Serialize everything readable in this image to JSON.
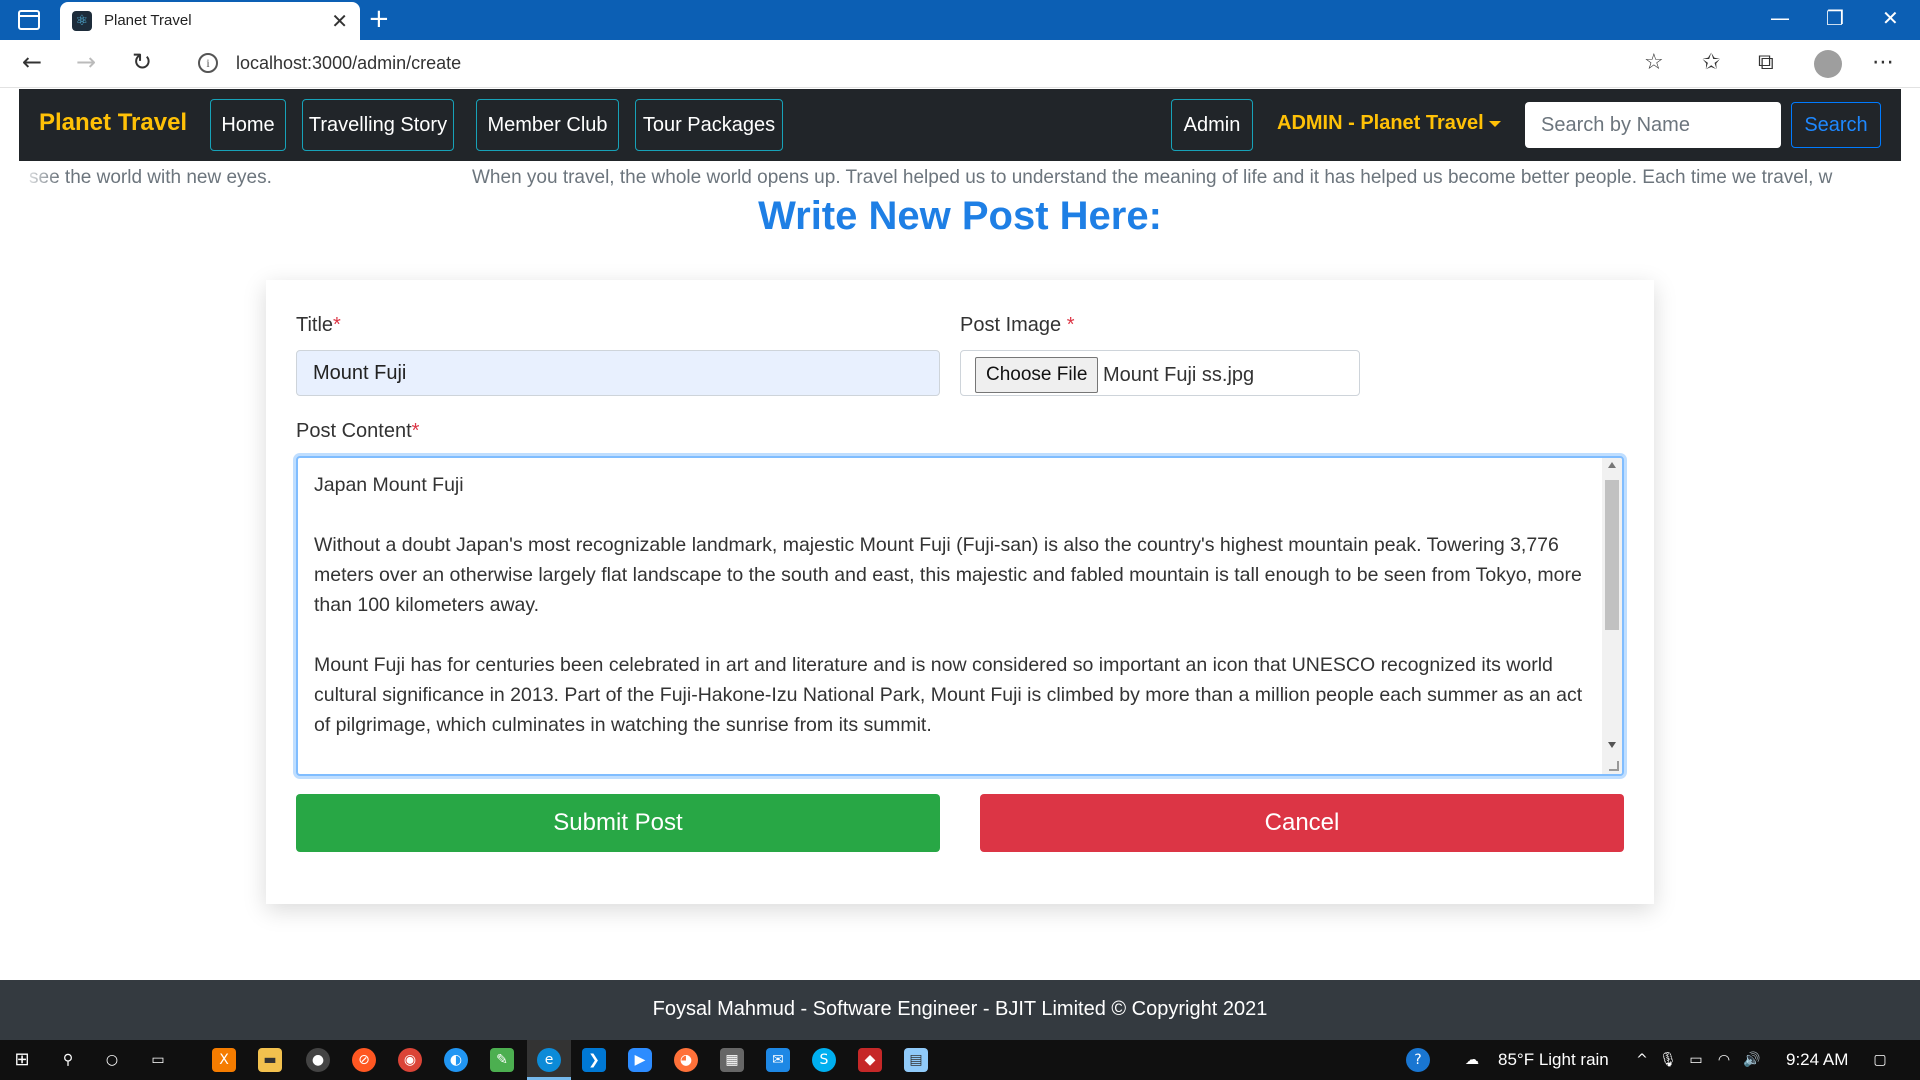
{
  "browser": {
    "tab_title": "Planet Travel",
    "url": "localhost:3000/admin/create"
  },
  "navbar": {
    "brand": "Planet Travel",
    "links": [
      "Home",
      "Travelling Story",
      "Member Club",
      "Tour Packages"
    ],
    "admin_link": "Admin",
    "admin_dropdown": "ADMIN - Planet Travel",
    "search_placeholder": "Search by Name",
    "search_button": "Search"
  },
  "marquee": {
    "left": "see the world with new eyes.",
    "right": "When you travel, the whole world opens up. Travel helped us to understand the meaning of life and it has helped us become better people. Each time we travel, w"
  },
  "page": {
    "title": "Write New Post Here:"
  },
  "form": {
    "title_label": "Title",
    "title_value": "Mount Fuji",
    "image_label": "Post Image ",
    "file_button": "Choose File",
    "file_name": "Mount Fuji ss.jpg",
    "content_label": "Post Content",
    "content_paragraphs": [
      "Japan Mount Fuji",
      "Without a doubt Japan's most recognizable landmark, majestic Mount Fuji (Fuji-san) is also the country's highest mountain peak. Towering 3,776 meters over an otherwise largely flat landscape to the south and east, this majestic and fabled mountain is tall enough to be seen from Tokyo, more than 100 kilometers away.",
      "Mount Fuji has for centuries been celebrated in art and literature and is now considered so important an icon that UNESCO recognized its world cultural significance in 2013. Part of the Fuji-Hakone-Izu National Park, Mount Fuji is climbed by more than a million people each summer as an act of pilgrimage, which culminates in watching the sunrise from its summit."
    ],
    "required_mark": "*",
    "submit": "Submit Post",
    "cancel": "Cancel"
  },
  "footer": {
    "text": "Foysal Mahmud - Software Engineer - BJIT Limited © Copyright 2021"
  },
  "taskbar": {
    "weather": "85°F  Light rain",
    "time": "9:24 AM"
  },
  "colors": {
    "brand": "#ffc107",
    "title_blue": "#1e7fe5",
    "submit": "#28a745",
    "cancel": "#dc3545",
    "navbar_bg": "#212529",
    "browser_tabbar": "#0c5fb4"
  }
}
